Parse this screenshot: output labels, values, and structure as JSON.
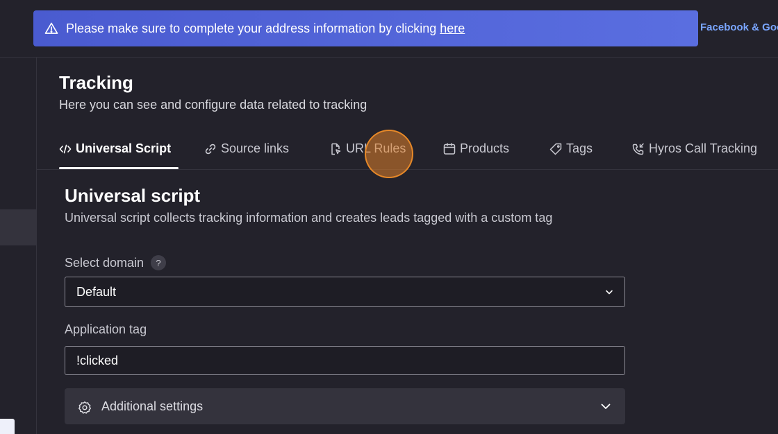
{
  "banner": {
    "message": "Please make sure to complete your address information by clicking",
    "link_text": "here",
    "side_link": "Facebook & Goo"
  },
  "header": {
    "title": "Tracking",
    "subtitle": "Here you can see and configure data related to tracking"
  },
  "tabs": [
    {
      "label": "Universal Script",
      "icon": "code-icon",
      "active": true
    },
    {
      "label": "Source links",
      "icon": "link-icon",
      "active": false
    },
    {
      "label": "URL Rules",
      "icon": "file-pointer-icon",
      "active": false
    },
    {
      "label": "Products",
      "icon": "calendar-box-icon",
      "active": false
    },
    {
      "label": "Tags",
      "icon": "tag-icon",
      "active": false
    },
    {
      "label": "Hyros Call Tracking",
      "icon": "phone-incoming-icon",
      "active": false
    }
  ],
  "section": {
    "title": "Universal script",
    "subtitle": "Universal script collects tracking information and creates leads tagged with a custom tag"
  },
  "domain_select": {
    "label": "Select domain",
    "help": "?",
    "value": "Default"
  },
  "application_tag": {
    "label": "Application tag",
    "value": "!clicked"
  },
  "additional_settings": {
    "label": "Additional settings"
  },
  "colors": {
    "background": "#23222b",
    "banner": "#4a5bd0",
    "link_accent": "#7aa6ff",
    "click_marker": "#e0802a"
  }
}
